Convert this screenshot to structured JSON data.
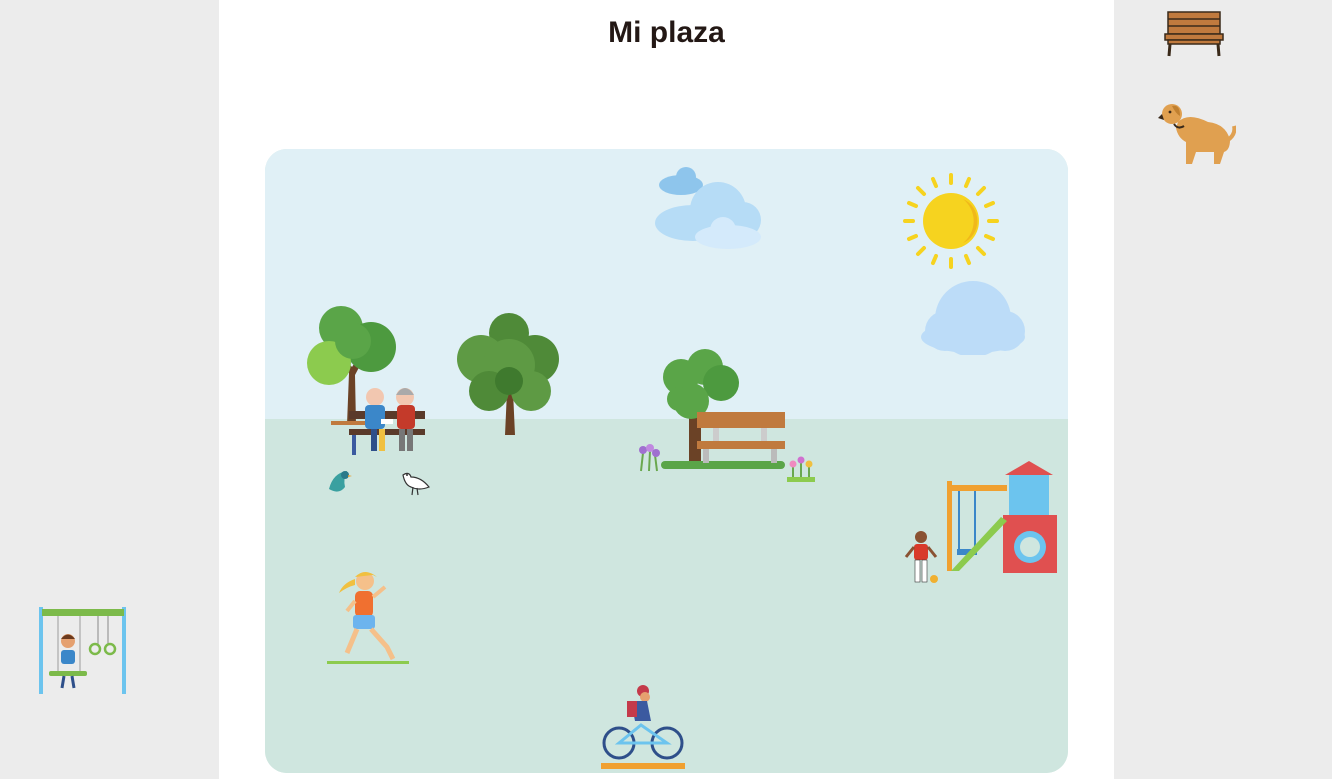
{
  "page": {
    "title": "Mi plaza"
  },
  "palette": {
    "sky": "#e0f0f6",
    "ground": "#cfe6df",
    "side": "#ececec",
    "title": "#231815",
    "sun": "#f6d31f",
    "cloud": "#bcdcf8",
    "tree_green": "#5aa548",
    "wood": "#c07a3e"
  },
  "sidebar_right": {
    "items": [
      {
        "name": "bench",
        "icon": "bench-icon"
      },
      {
        "name": "dog",
        "icon": "dog-icon"
      }
    ]
  },
  "sidebar_left": {
    "items": [
      {
        "name": "swing-with-child",
        "icon": "swing-set-icon"
      }
    ]
  },
  "scene": {
    "stickers": [
      "sun-icon",
      "cloud-icon",
      "cloud-icon",
      "tree-icon",
      "tree-icon",
      "tree-icon",
      "elderly-couple-on-bench-icon",
      "bench-icon",
      "flowers-icon",
      "bird-icon",
      "pigeon-icon",
      "runner-icon",
      "cyclist-icon",
      "playground-icon",
      "child-with-ball-icon"
    ]
  }
}
